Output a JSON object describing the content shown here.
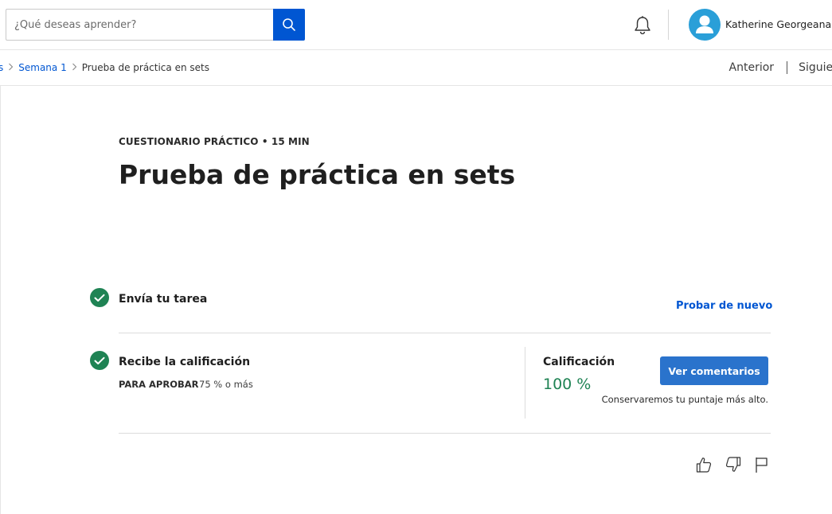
{
  "header": {
    "search": {
      "placeholder": "¿Qué deseas aprender?",
      "icon": "search-icon"
    },
    "notifications_icon": "bell-icon",
    "user": {
      "name": "Katherine Georgeana ...",
      "avatar_icon": "user-avatar-icon",
      "avatar_color": "#2a9fd8"
    }
  },
  "breadcrumb": {
    "items": [
      {
        "label": "s"
      },
      {
        "label": "Semana 1"
      },
      {
        "label": "Prueba de práctica en sets"
      }
    ],
    "prev_label": "Anterior",
    "next_label": "Siguien"
  },
  "main": {
    "eyebrow": "CUESTIONARIO PRÁCTICO • 15 MIN",
    "title": "Prueba de práctica en sets",
    "steps": [
      {
        "title": "Envía tu tarea",
        "action": "Probar de nuevo",
        "status": "complete"
      },
      {
        "title": "Recibe la calificación",
        "pass_label": "PARA APROBAR",
        "pass_value": "75 % o más",
        "status": "complete"
      }
    ],
    "grade": {
      "label": "Calificación",
      "value": "100 %",
      "button_label": "Ver comentarios",
      "note": "Conservaremos tu puntaje más alto."
    },
    "feedback_icons": [
      "thumbs-up-icon",
      "thumbs-down-icon",
      "flag-icon"
    ]
  },
  "colors": {
    "accent": "#0056d2",
    "button": "#2a73cc",
    "success": "#1f8354"
  }
}
